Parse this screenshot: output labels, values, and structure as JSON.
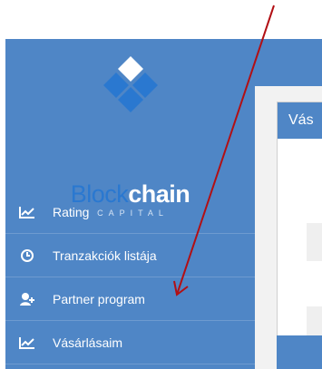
{
  "brand": {
    "name_part1": "Block",
    "name_part2": "chain",
    "subtitle": "CAPITAL",
    "logo_icon": "diamond-logo-icon"
  },
  "sidebar": {
    "items": [
      {
        "label": "Rating",
        "icon": "chart-line-icon"
      },
      {
        "label": "Tranzakciók listája",
        "icon": "clock-icon"
      },
      {
        "label": "Partner program",
        "icon": "user-add-icon"
      },
      {
        "label": "Vásárlásaim",
        "icon": "chart-line-icon"
      }
    ]
  },
  "main": {
    "card_title": "Vás"
  },
  "colors": {
    "sidebar_bg": "#4f86c6",
    "brand_blue": "#2a78d0",
    "annotation_arrow": "#b20f14"
  }
}
